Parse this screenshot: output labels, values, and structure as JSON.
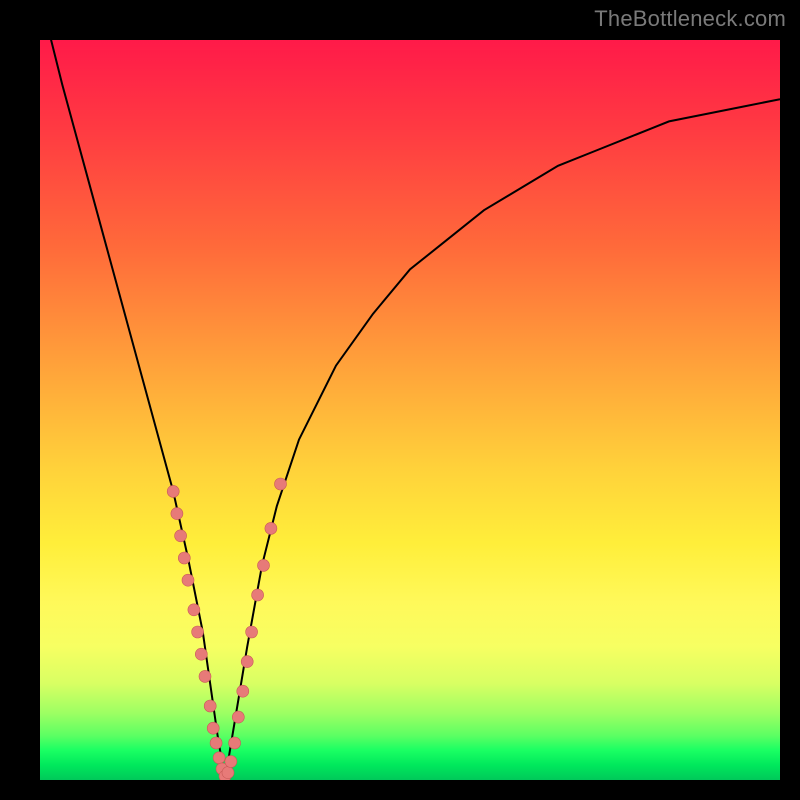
{
  "watermark": "TheBottleneck.com",
  "colors": {
    "frame": "#000000",
    "gradient_top": "#ff1a49",
    "gradient_mid": "#ffd23a",
    "gradient_bottom": "#00c85a",
    "curve_stroke": "#000000",
    "dot_fill": "#e77a78",
    "dot_stroke": "#c85a57"
  },
  "chart_data": {
    "type": "line",
    "title": "",
    "xlabel": "",
    "ylabel": "",
    "xlim": [
      0,
      100
    ],
    "ylim": [
      0,
      100
    ],
    "grid": false,
    "legend": false,
    "series": [
      {
        "name": "curve",
        "x": [
          0,
          3,
          6,
          9,
          12,
          15,
          18,
          20,
          22,
          23,
          24,
          25,
          26,
          28,
          30,
          32,
          35,
          40,
          45,
          50,
          55,
          60,
          65,
          70,
          75,
          80,
          85,
          90,
          95,
          100
        ],
        "values": [
          106,
          94,
          83,
          72,
          61,
          50,
          39,
          30,
          20,
          13,
          6,
          0,
          6,
          18,
          29,
          37,
          46,
          56,
          63,
          69,
          73,
          77,
          80,
          83,
          85,
          87,
          89,
          90,
          91,
          92
        ]
      }
    ],
    "dots": {
      "name": "scatter",
      "x": [
        18.0,
        18.5,
        19.0,
        19.5,
        20.0,
        20.8,
        21.3,
        21.8,
        22.3,
        23.0,
        23.4,
        23.8,
        24.2,
        24.6,
        25.0,
        25.4,
        25.8,
        26.3,
        26.8,
        27.4,
        28.0,
        28.6,
        29.4,
        30.2,
        31.2,
        32.5
      ],
      "values": [
        39.0,
        36.0,
        33.0,
        30.0,
        27.0,
        23.0,
        20.0,
        17.0,
        14.0,
        10.0,
        7.0,
        5.0,
        3.0,
        1.5,
        0.5,
        1.0,
        2.5,
        5.0,
        8.5,
        12.0,
        16.0,
        20.0,
        25.0,
        29.0,
        34.0,
        40.0
      ]
    },
    "annotations": []
  }
}
